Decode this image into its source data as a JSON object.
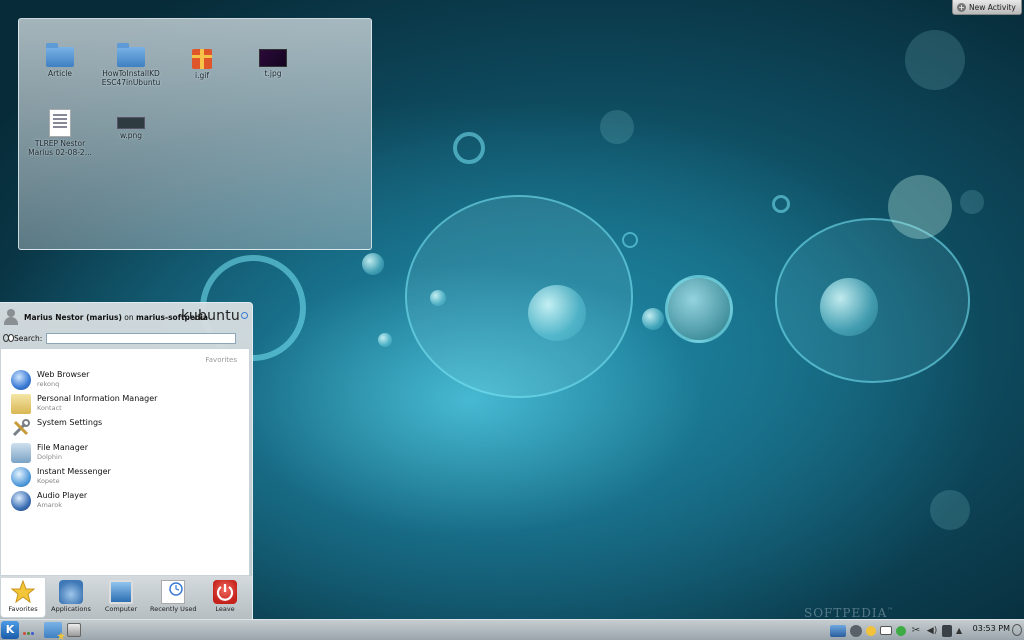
{
  "activity_button": {
    "label": "New Activity"
  },
  "folder_view": {
    "icons": [
      {
        "label": "Article",
        "type": "folder"
      },
      {
        "label": "HowToInstallKD\nESC47inUbuntu",
        "type": "folder"
      },
      {
        "label": "i.gif",
        "type": "gif"
      },
      {
        "label": "t.jpg",
        "type": "jpg"
      },
      {
        "label": "TLREP Nestor\nMarius 02-08-2...",
        "type": "document"
      },
      {
        "label": "w.png",
        "type": "png"
      }
    ]
  },
  "launcher": {
    "user_name": "Marius Nestor (marius)",
    "user_on": "on",
    "host": "marius-softpedia",
    "brand": "kubuntu",
    "search_label": "Search:",
    "search_value": "",
    "section_caption": "Favorites",
    "favorites": [
      {
        "name": "Web Browser",
        "sub": "rekonq",
        "icon": "globe-icon"
      },
      {
        "name": "Personal Information Manager",
        "sub": "Kontact",
        "icon": "pim-icon"
      },
      {
        "name": "System Settings",
        "sub": "",
        "icon": "tools-icon"
      },
      {
        "name": "File Manager",
        "sub": "Dolphin",
        "icon": "file-manager-icon"
      },
      {
        "name": "Instant Messenger",
        "sub": "Kopete",
        "icon": "messenger-icon"
      },
      {
        "name": "Audio Player",
        "sub": "Amarok",
        "icon": "audio-player-icon"
      }
    ],
    "tabs": [
      {
        "label": "Favorites",
        "icon": "star-icon",
        "active": true
      },
      {
        "label": "Applications",
        "icon": "applications-icon",
        "active": false
      },
      {
        "label": "Computer",
        "icon": "computer-icon",
        "active": false
      },
      {
        "label": "Recently Used",
        "icon": "recent-icon",
        "active": false
      },
      {
        "label": "Leave",
        "icon": "leave-icon",
        "active": false
      }
    ]
  },
  "taskbar": {
    "kicker_glyph": "K",
    "clock": "03:53 PM",
    "tray_up_glyph": "▲",
    "tray_cut_glyph": "✂",
    "tray_vol_glyph": "◀)"
  },
  "watermark": {
    "text": "SOFTPEDIA",
    "mark": "™"
  },
  "colors": {
    "accent": "#3a7bd5",
    "wallpaper": "#0e4a5e"
  }
}
